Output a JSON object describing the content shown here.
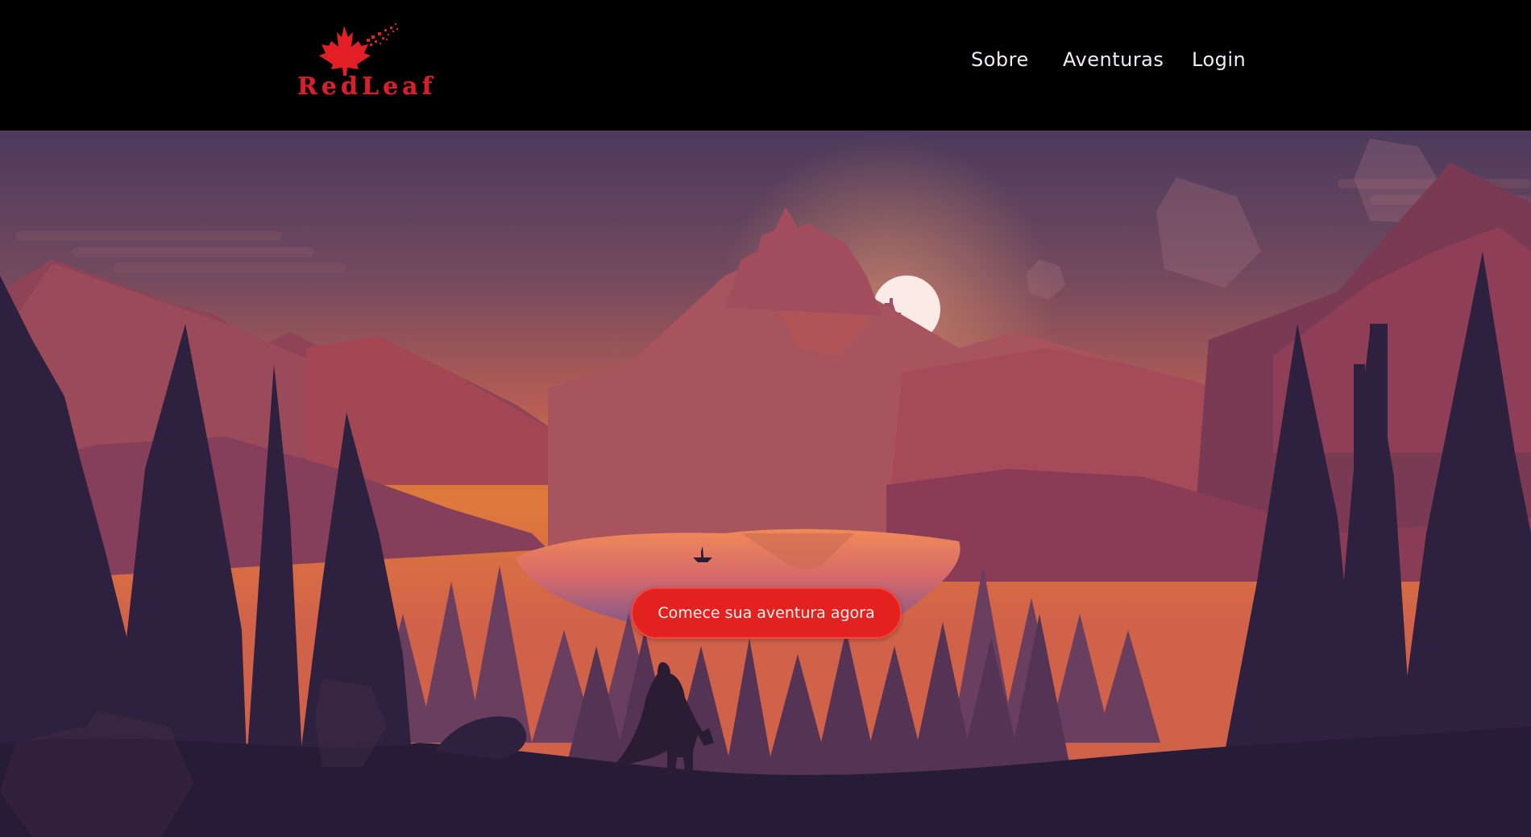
{
  "brand": {
    "name": "RedLeaf",
    "logo_icon": "maple-leaf-icon",
    "color": "#d8202a"
  },
  "nav": {
    "items": [
      {
        "label": "Sobre"
      },
      {
        "label": "Aventuras"
      },
      {
        "label": "Login"
      }
    ]
  },
  "hero": {
    "cta_label": "Comece sua aventura agora",
    "cta_color": "#e3221f",
    "sky_top": "#4c3a5c",
    "sky_glow": "#e07a3c",
    "forest_dark": "#271c37"
  }
}
